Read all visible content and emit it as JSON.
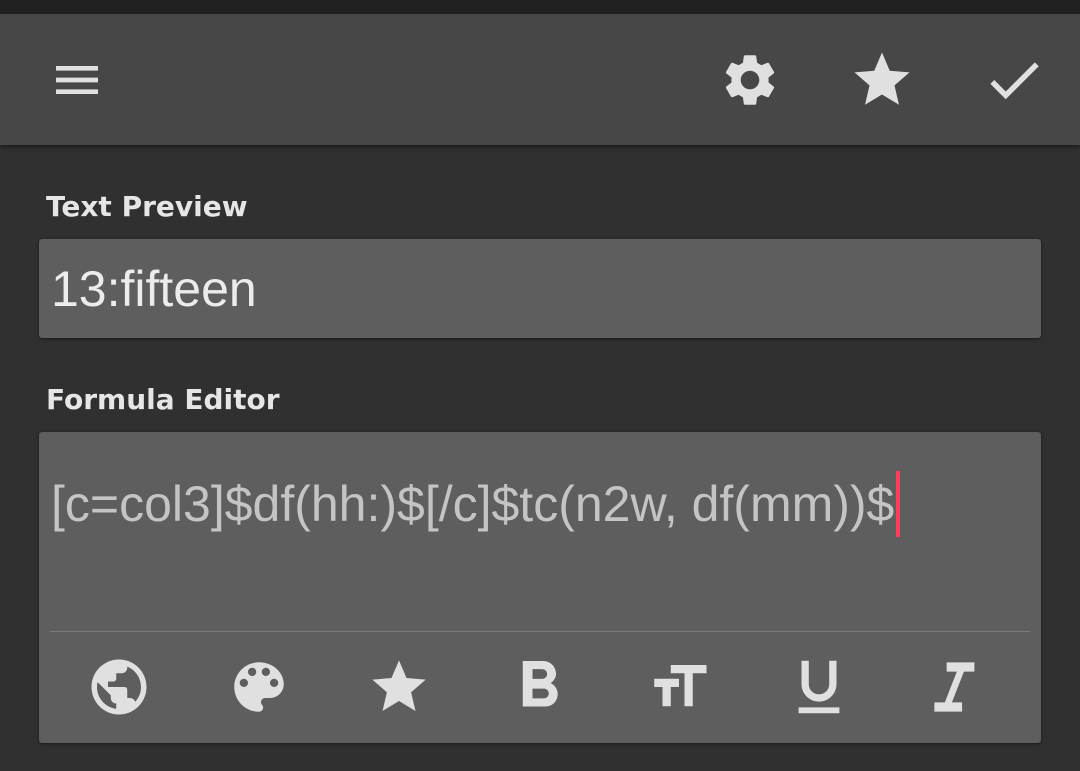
{
  "toolbar": {
    "icons": {
      "menu": "menu-icon",
      "settings": "gear-icon",
      "favorite": "star-icon",
      "done": "check-icon"
    }
  },
  "preview": {
    "label": "Text Preview",
    "value": "13:fifteen"
  },
  "editor": {
    "label": "Formula Editor",
    "value": "[c=col3]$df(hh:)$[/c]$tc(n2w, df(mm))$"
  },
  "format_bar": {
    "icons": [
      "globe-icon",
      "palette-icon",
      "star-icon",
      "bold-icon",
      "text-size-icon",
      "underline-icon",
      "italic-icon"
    ]
  },
  "colors": {
    "background": "#303030",
    "toolbar": "#474747",
    "card": "#5e5e5e",
    "icon": "#e0e0e0",
    "caret": "#ff3d5a"
  }
}
